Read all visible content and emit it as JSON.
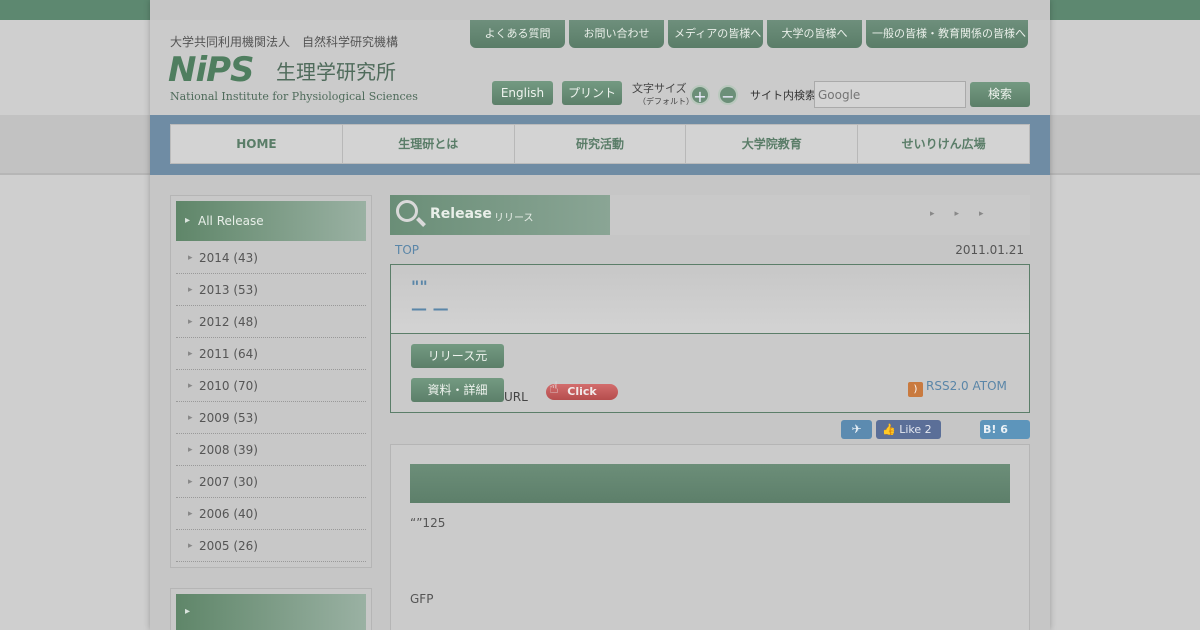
{
  "header": {
    "org_line": "大学共同利用機関法人　自然科学研究機構",
    "logo_mark": "NiPS",
    "logo_jp": "生理学研究所",
    "logo_en": "National Institute for Physiological Sciences"
  },
  "top_tabs": [
    {
      "label": "よくある質問"
    },
    {
      "label": "お問い合わせ"
    },
    {
      "label": "メディアの皆様へ"
    },
    {
      "label": "大学の皆様へ"
    },
    {
      "label": "一般の皆様・教育関係の皆様へ"
    }
  ],
  "tools": {
    "english": "English",
    "print": "プリント",
    "fontsize_label": "文字サイズ",
    "fontsize_sub": "（デフォルト）",
    "plus": "+",
    "minus": "−",
    "search_label": "サイト内検索",
    "search_placeholder": "Google",
    "search_button": "検索"
  },
  "nav": [
    {
      "label": "HOME"
    },
    {
      "label": "生理研とは"
    },
    {
      "label": "研究活動"
    },
    {
      "label": "大学院教育"
    },
    {
      "label": "せいりけん広場"
    }
  ],
  "sidebar": {
    "active": "All Release",
    "years": [
      {
        "label": "2014 (43)"
      },
      {
        "label": "2013 (53)"
      },
      {
        "label": "2012 (48)"
      },
      {
        "label": "2011 (64)"
      },
      {
        "label": "2010 (70)"
      },
      {
        "label": "2009 (53)"
      },
      {
        "label": "2008 (39)"
      },
      {
        "label": "2007 (30)"
      },
      {
        "label": "2006 (40)"
      },
      {
        "label": "2005 (26)"
      }
    ]
  },
  "release": {
    "title_en": "Release",
    "title_jp": "リリース",
    "arrows": "▸▸▸",
    "breadcrumb": "TOP",
    "date": "2011.01.21",
    "headline_1": "\"\"",
    "headline_2": "— —",
    "source_button": "リリース元",
    "detail_button": "資料・詳細",
    "url_label": "URL",
    "click_label": "Click",
    "rss_label": "RSS2.0 ATOM",
    "fb_like": "Like 2",
    "hatena": "B! 6",
    "body_line_1": "“”125",
    "body_line_2": "GFP"
  }
}
